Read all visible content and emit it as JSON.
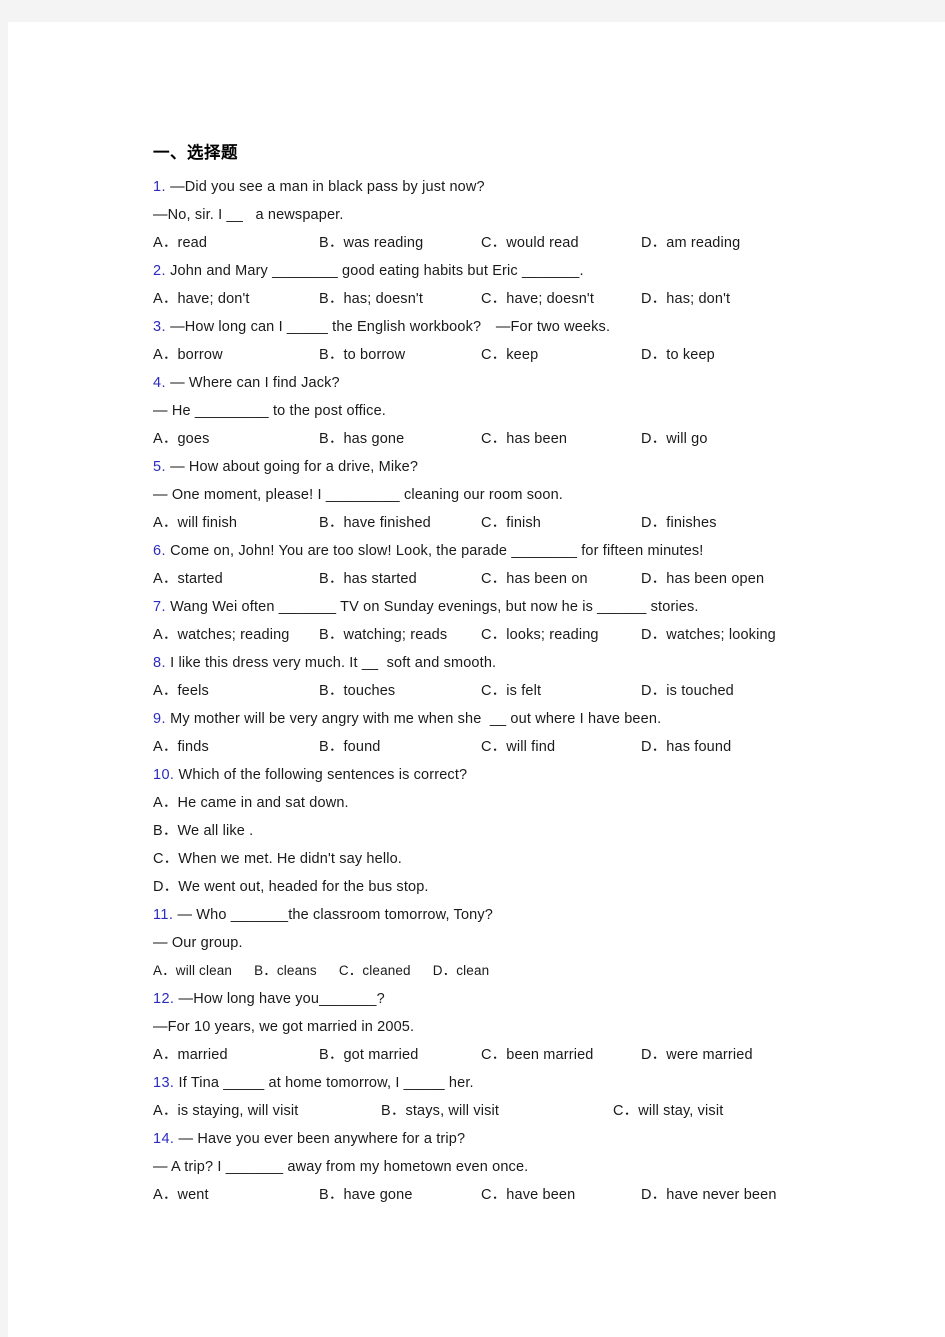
{
  "document": {
    "heading": "一、选择题",
    "page_background": "#ffffff",
    "canvas_background": "#f4f4f4",
    "number_color": "#2b2bbf",
    "text_color": "#1a1a1a"
  },
  "questions": [
    {
      "number": "1.",
      "lines": [
        "—Did you see a man in black pass by just now?",
        "—No, sir. I __   a newspaper."
      ],
      "layout": "cols4",
      "options": [
        "A．read",
        "B．was reading",
        "C．would read",
        "D．am reading"
      ]
    },
    {
      "number": "2.",
      "lines": [
        "John and Mary ________ good eating habits but Eric _______."
      ],
      "layout": "cols4",
      "options": [
        "A．have; don't",
        "B．has; doesn't",
        "C．have; doesn't",
        "D．has; don't"
      ]
    },
    {
      "number": "3.",
      "lines": [
        "—How long can I _____ the English workbook?　—For two weeks."
      ],
      "layout": "cols4",
      "options": [
        "A．borrow",
        "B．to borrow",
        "C．keep",
        "D．to keep"
      ]
    },
    {
      "number": "4.",
      "lines": [
        "— Where can I find Jack?",
        "— He _________ to the post office."
      ],
      "layout": "cols4",
      "options": [
        "A．goes",
        "B．has gone",
        "C．has been",
        "D．will go"
      ]
    },
    {
      "number": "5.",
      "lines": [
        "— How about going for a drive, Mike?",
        "— One moment, please! I _________ cleaning our room soon."
      ],
      "layout": "cols4",
      "options": [
        "A．will finish",
        "B．have finished",
        "C．finish",
        "D．finishes"
      ]
    },
    {
      "number": "6.",
      "lines": [
        "Come on, John! You are too slow! Look, the parade ________ for fifteen minutes!"
      ],
      "layout": "cols4",
      "options": [
        "A．started",
        "B．has started",
        "C．has been on",
        "D．has been open"
      ]
    },
    {
      "number": "7.",
      "lines": [
        "Wang Wei often _______ TV on Sunday evenings, but now he is ______ stories."
      ],
      "layout": "cols4",
      "options": [
        "A．watches; reading",
        "B．watching; reads",
        "C．looks; reading",
        "D．watches; looking"
      ]
    },
    {
      "number": "8.",
      "lines": [
        "I like this dress very much. It __  soft and smooth."
      ],
      "layout": "cols4",
      "options": [
        "A．feels",
        "B．touches",
        "C．is felt",
        "D．is touched"
      ]
    },
    {
      "number": "9.",
      "lines": [
        "My mother will be very angry with me when she  __ out where I have been."
      ],
      "layout": "cols4",
      "options": [
        "A．finds",
        "B．found",
        "C．will find",
        "D．has found"
      ]
    },
    {
      "number": "10.",
      "lines": [
        "Which of the following sentences is correct?"
      ],
      "layout": "stacked",
      "options": [
        "A．He came in and sat down.",
        "B．We all like .",
        "C．When we met. He didn't say hello.",
        "D．We went out, headed for the bus stop."
      ]
    },
    {
      "number": "11.",
      "lines": [
        "— Who _______the classroom tomorrow, Tony?",
        "— Our group."
      ],
      "layout": "compact",
      "options": [
        "A．will clean",
        "B．cleans",
        "C．cleaned",
        "D．clean"
      ]
    },
    {
      "number": "12.",
      "lines": [
        "—How long have you_______?",
        "—For 10 years, we got married in 2005."
      ],
      "layout": "cols4",
      "options": [
        "A．married",
        "B．got married",
        "C．been married",
        "D．were married"
      ]
    },
    {
      "number": "13.",
      "lines": [
        "If Tina _____ at home tomorrow, I _____ her."
      ],
      "layout": "cols3",
      "options": [
        "A．is staying, will visit",
        "B．stays, will visit",
        "C．will stay, visit"
      ]
    },
    {
      "number": "14.",
      "lines": [
        "— Have you ever been anywhere for a trip?",
        "— A trip? I _______ away from my hometown even once."
      ],
      "layout": "cols4",
      "options": [
        "A．went",
        "B．have gone",
        "C．have been",
        "D．have never been"
      ]
    }
  ]
}
